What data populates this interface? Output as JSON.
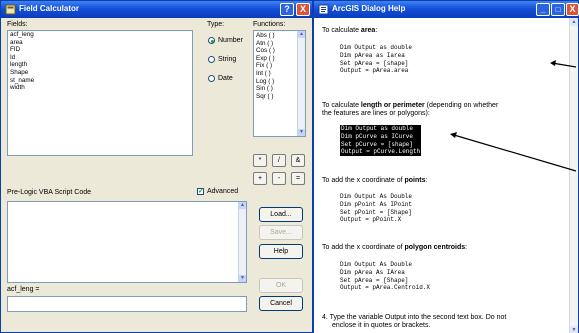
{
  "field_calculator": {
    "title": "Field Calculator",
    "help_btn": "?",
    "close_btn": "X",
    "fields_label": "Fields:",
    "fields": [
      "acf_leng",
      "area",
      "FID",
      "Id",
      "length",
      "Shape",
      "st_name",
      "width"
    ],
    "type_label": "Type:",
    "type_options": [
      "Number",
      "String",
      "Date"
    ],
    "type_selected": "Number",
    "functions_label": "Functions:",
    "functions": [
      "Abs ( )",
      "Atn ( )",
      "Cos ( )",
      "Exp ( )",
      "Fix ( )",
      "Int ( )",
      "Log ( )",
      "Sin ( )",
      "Sqr ( )"
    ],
    "operators": [
      "*",
      "/",
      "&",
      "+",
      "-",
      "="
    ],
    "prelogic_label": "Pre-Logic VBA Script Code",
    "advanced_label": "Advanced",
    "advanced_checked": true,
    "buttons": {
      "load": "Load...",
      "save": "Save...",
      "help": "Help",
      "ok": "OK",
      "cancel": "Cancel"
    },
    "expression_label": "acf_leng ="
  },
  "help_window": {
    "title": "ArcGIS Dialog Help",
    "area_intro_prefix": "To calculate ",
    "area_intro_bold": "area",
    "area_intro_suffix": ":",
    "area_code": [
      "Dim Output as double",
      "Dim pArea as Iarea",
      "Set pArea = [shape]",
      "Output = pArea.area"
    ],
    "length_intro_prefix": "To calculate ",
    "length_intro_bold": "length or perimeter",
    "length_intro_suffix": " (depending on whether",
    "length_intro_line2": "the features are lines or polygons):",
    "length_code": [
      "Dim Output as double",
      "Dim pCurve as ICurve",
      "Set pCurve = [shape]",
      "Output = pCurve.Length"
    ],
    "points_intro_prefix": "To add the x coordinate of ",
    "points_intro_bold": "points",
    "points_intro_suffix": ":",
    "points_code": [
      "Dim Output As Double",
      "Dim pPoint As IPoint",
      "Set pPoint = [Shape]",
      "Output = pPoint.X"
    ],
    "centroid_intro_prefix": "To add the x coordinate of ",
    "centroid_intro_bold": "polygon centroids",
    "centroid_intro_suffix": ":",
    "centroid_code": [
      "Dim Output As Double",
      "Dim pArea As IArea",
      "Set pArea = [Shape]",
      "Output = pArea.Centroid.X"
    ],
    "step4_line1": "4.  Type the variable Output into the second text box. Do not",
    "step4_line2": "enclose it in quotes or brackets."
  }
}
